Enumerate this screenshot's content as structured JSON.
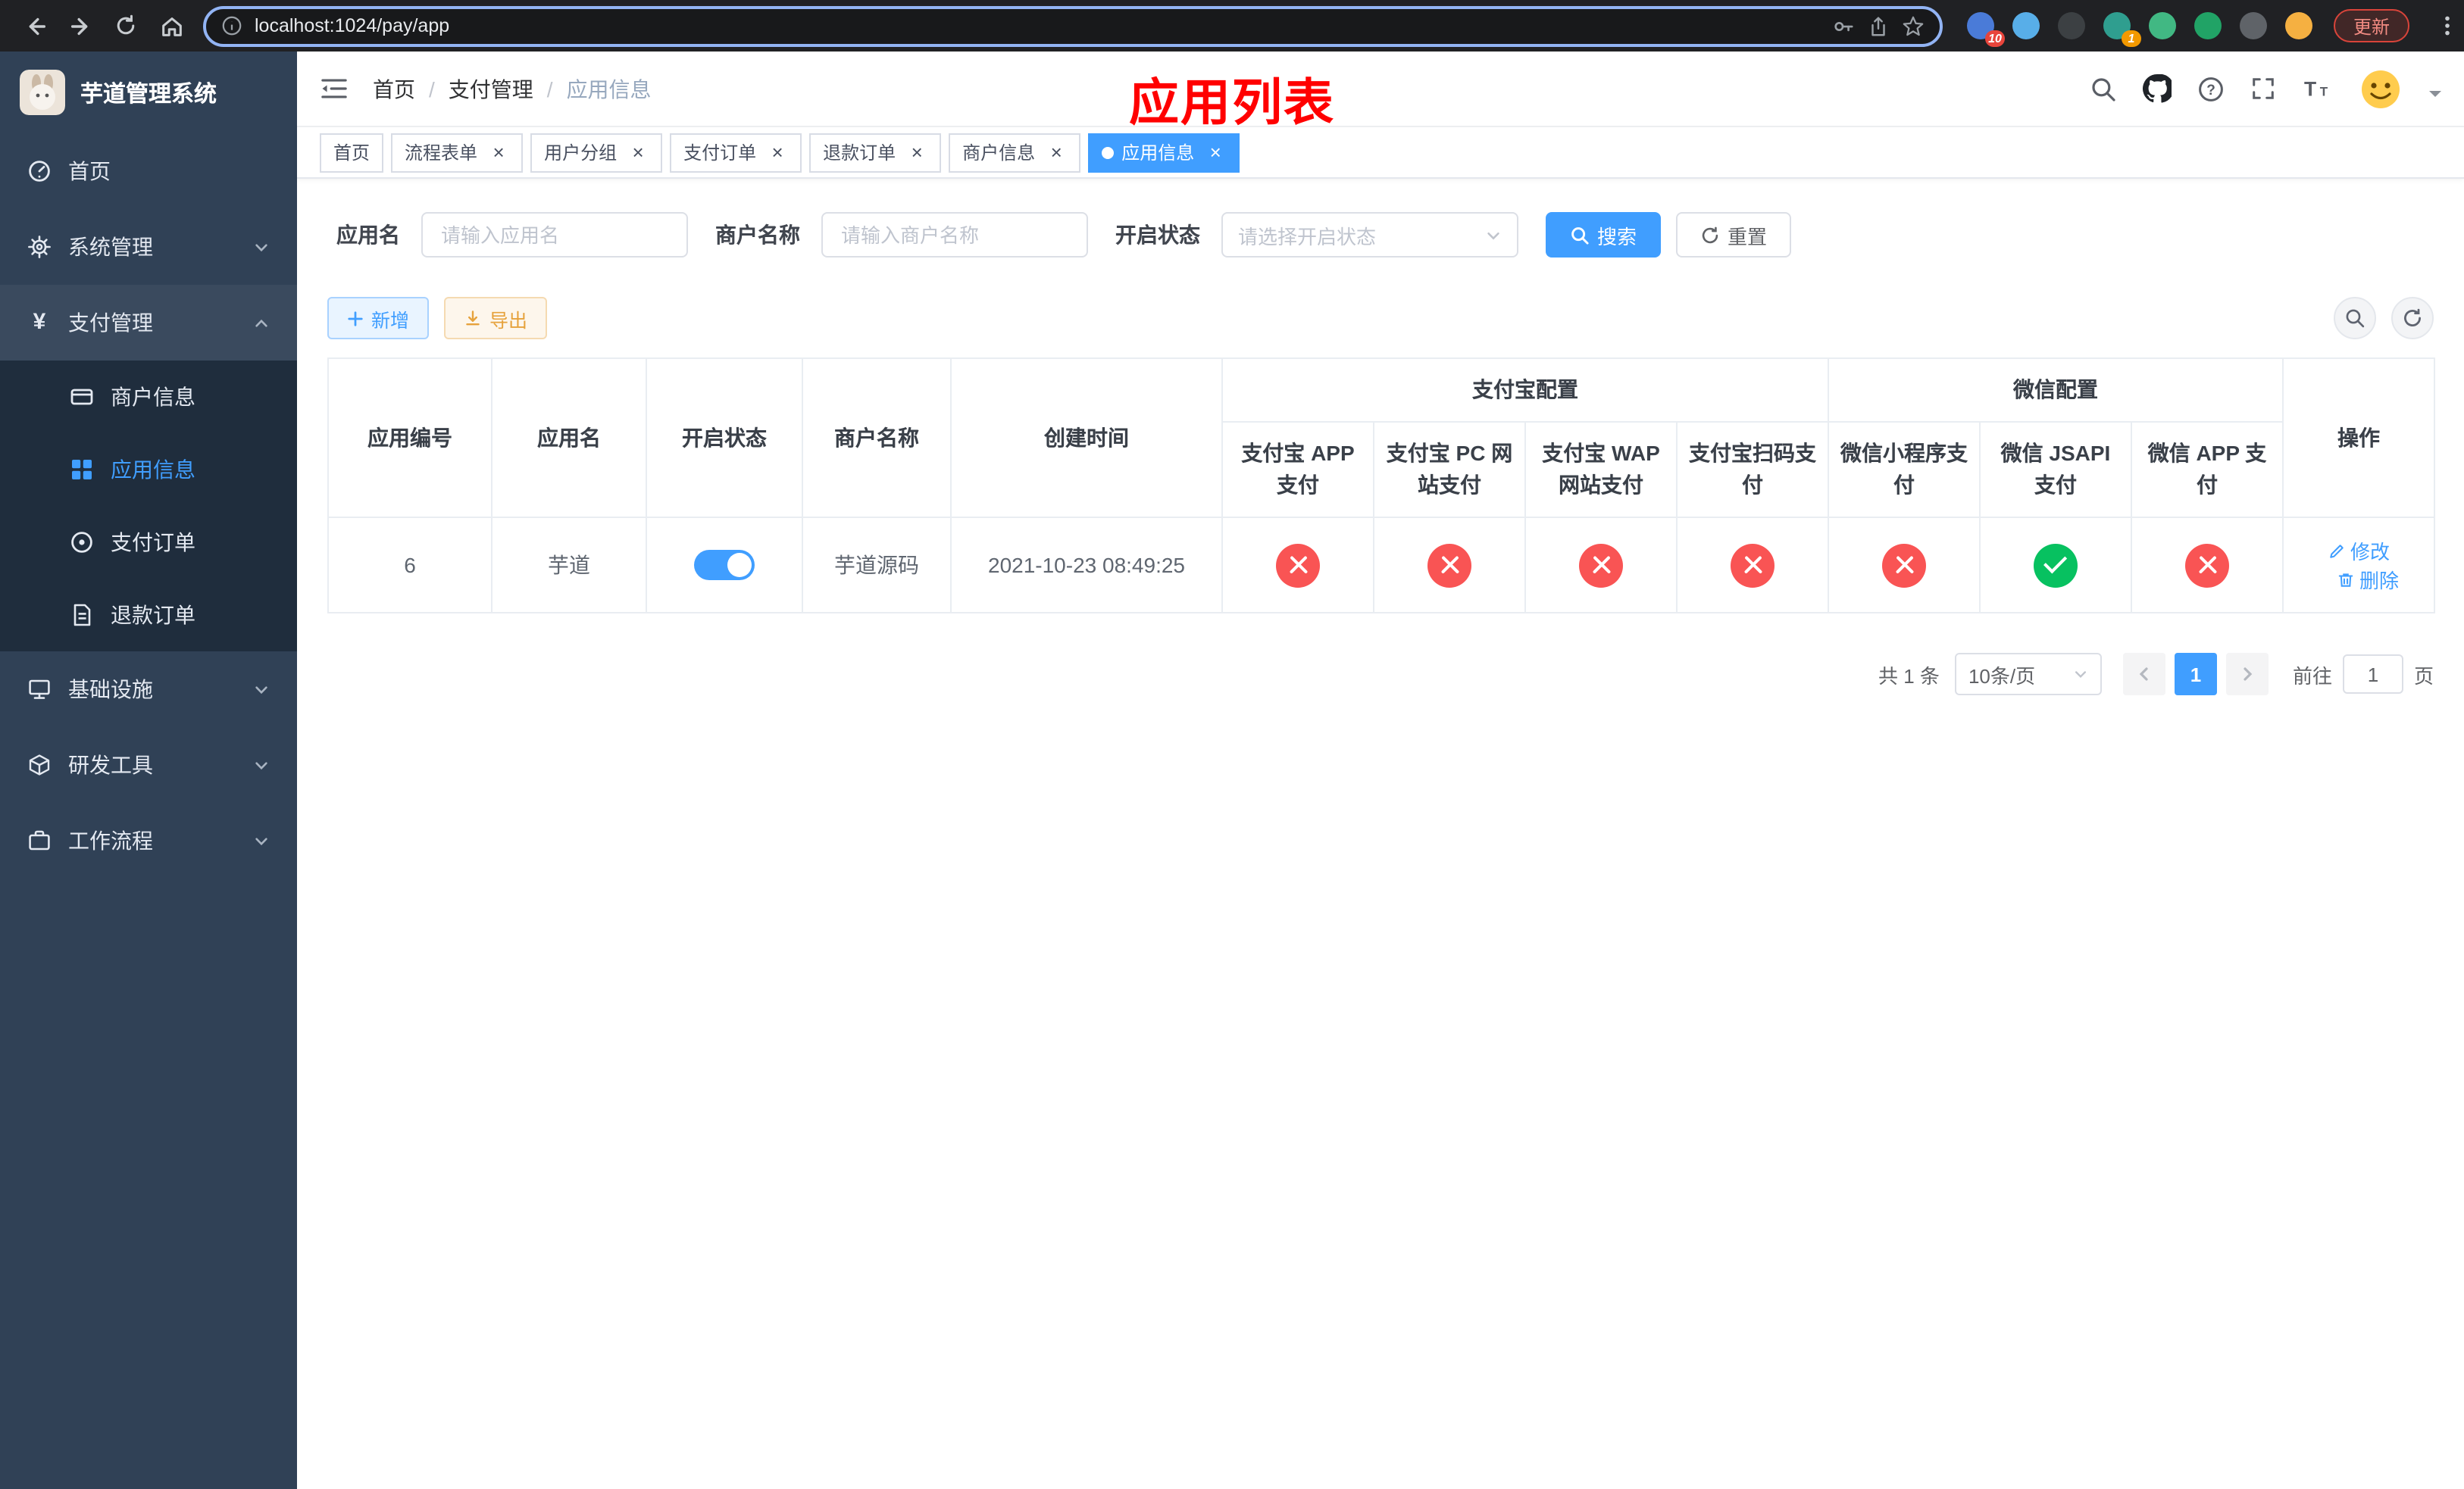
{
  "colors": {
    "accent": "#409eff",
    "success_green": "#07c160",
    "danger_red": "#f95454",
    "warning_orange": "#e6a23c",
    "title_red": "#ff0000",
    "sidebar_bg": "#304156",
    "submenu_bg": "#1f2d3d"
  },
  "browser": {
    "nav_icons": [
      "back-icon",
      "forward-icon",
      "refresh-icon",
      "home-icon"
    ],
    "url": "localhost:1024/pay/app",
    "address_icons": [
      "info-icon",
      "key-icon",
      "share-icon",
      "star-icon"
    ],
    "update_label": "更新",
    "menu_icon": "kebab-menu-icon",
    "extensions": [
      {
        "name": "extension-icon",
        "color": "#4a7bd8",
        "badge": "10",
        "badge_color": "#e8453c"
      },
      {
        "name": "extension-icon",
        "color": "#58aee8"
      },
      {
        "name": "extension-icon",
        "color": "#3c4043"
      },
      {
        "name": "extension-icon",
        "color": "#2f9e8f",
        "badge": "1",
        "badge_color": "#f29900"
      },
      {
        "name": "extension-icon",
        "color": "#41b883"
      },
      {
        "name": "extension-icon",
        "color": "#21a366"
      },
      {
        "name": "extension-icon",
        "color": "#5f6368"
      },
      {
        "name": "extension-icon",
        "color": "#f5b041"
      }
    ]
  },
  "sidebar": {
    "logo_title": "芋道管理系统",
    "items": [
      {
        "label": "首页",
        "icon": "dashboard-icon"
      },
      {
        "label": "系统管理",
        "icon": "gear-icon"
      },
      {
        "label": "支付管理",
        "icon": "yen-icon",
        "children": [
          {
            "label": "商户信息",
            "icon": "card-icon"
          },
          {
            "label": "应用信息",
            "icon": "grid-icon",
            "active": true
          },
          {
            "label": "支付订单",
            "icon": "order-icon"
          },
          {
            "label": "退款订单",
            "icon": "document-icon"
          }
        ]
      },
      {
        "label": "基础设施",
        "icon": "monitor-icon"
      },
      {
        "label": "研发工具",
        "icon": "toolbox-icon"
      },
      {
        "label": "工作流程",
        "icon": "workflow-icon"
      }
    ]
  },
  "navbar": {
    "breadcrumb": [
      "首页",
      "支付管理",
      "应用信息"
    ],
    "separator": "/",
    "page_title": "应用列表",
    "right_icons": [
      "search-icon",
      "github-icon",
      "help-icon",
      "fullscreen-icon",
      "font-size-icon",
      "avatar"
    ]
  },
  "tags": [
    {
      "label": "首页",
      "closable": false,
      "active": false
    },
    {
      "label": "流程表单",
      "closable": true,
      "active": false
    },
    {
      "label": "用户分组",
      "closable": true,
      "active": false
    },
    {
      "label": "支付订单",
      "closable": true,
      "active": false
    },
    {
      "label": "退款订单",
      "closable": true,
      "active": false
    },
    {
      "label": "商户信息",
      "closable": true,
      "active": false
    },
    {
      "label": "应用信息",
      "closable": true,
      "active": true
    }
  ],
  "filters": {
    "app_name": {
      "label": "应用名",
      "placeholder": "请输入应用名",
      "value": ""
    },
    "merchant_name": {
      "label": "商户名称",
      "placeholder": "请输入商户名称",
      "value": ""
    },
    "status": {
      "label": "开启状态",
      "placeholder": "请选择开启状态",
      "value": ""
    },
    "search_label": "搜索",
    "reset_label": "重置"
  },
  "toolbar": {
    "add_label": "新增",
    "export_label": "导出",
    "right_icons": [
      "search-icon",
      "refresh-icon"
    ]
  },
  "table": {
    "columns": {
      "app_id": "应用编号",
      "app_name": "应用名",
      "status": "开启状态",
      "merchant_name": "商户名称",
      "create_time": "创建时间",
      "alipay_group": "支付宝配置",
      "wechat_group": "微信配置",
      "sub_columns": [
        "支付宝 APP 支付",
        "支付宝 PC 网站支付",
        "支付宝 WAP 网站支付",
        "支付宝扫码支付",
        "微信小程序支付",
        "微信 JSAPI 支付",
        "微信 APP 支付"
      ],
      "actions": "操作"
    },
    "rows": [
      {
        "app_id": "6",
        "app_name": "芋道",
        "enabled": true,
        "merchant_name": "芋道源码",
        "create_time": "2021-10-23 08:49:25",
        "statuses": [
          "no",
          "no",
          "no",
          "no",
          "no",
          "yes",
          "no"
        ],
        "edit_label": "修改",
        "delete_label": "删除"
      }
    ]
  },
  "pagination": {
    "total_label": "共 1 条",
    "page_size": "10条/页",
    "current_page": "1",
    "goto_label": "前往",
    "goto_value": "1",
    "page_unit": "页"
  }
}
